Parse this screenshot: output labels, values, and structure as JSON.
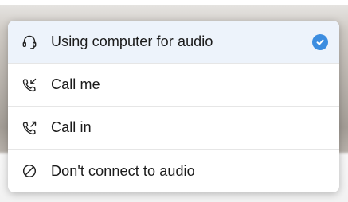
{
  "audio_menu": {
    "items": [
      {
        "label": "Using computer for audio",
        "icon": "headset-icon",
        "selected": true
      },
      {
        "label": "Call me",
        "icon": "phone-incoming-icon",
        "selected": false
      },
      {
        "label": "Call in",
        "icon": "phone-outgoing-icon",
        "selected": false
      },
      {
        "label": "Don't connect to audio",
        "icon": "no-audio-icon",
        "selected": false
      }
    ],
    "selected_indicator_color": "#3c8de0"
  }
}
